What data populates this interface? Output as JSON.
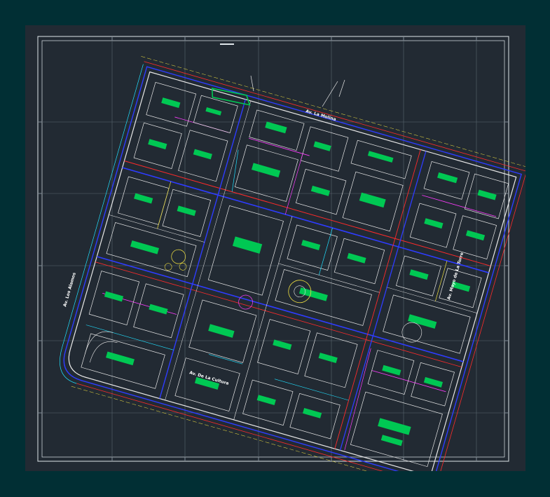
{
  "drawing": {
    "streets": {
      "left": "Av. Los Alamos",
      "top": "Av. La Molina",
      "bottom": "Av. De La Cultura",
      "right": "Av. Mayo de La Torre"
    },
    "colors": {
      "background": "#012f34",
      "sheet": "#222a33",
      "frame": "#dfe6ea",
      "grid": "#5b6670",
      "building": "#00c853",
      "road_blue": "#2e3cff",
      "road_red": "#ff2a2a",
      "outline": "#e8e8e8",
      "magenta": "#ff3cff",
      "cyan": "#20e0ff",
      "yellow": "#f0e040"
    }
  }
}
